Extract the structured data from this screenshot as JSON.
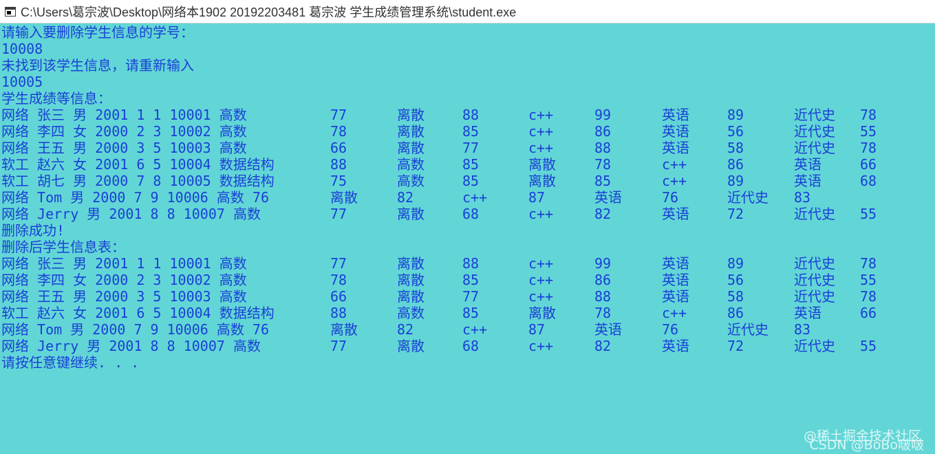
{
  "window": {
    "title": "C:\\Users\\葛宗波\\Desktop\\网络本1902 20192203481 葛宗波 学生成绩管理系统\\student.exe"
  },
  "console": {
    "prompt_delete": "请输入要删除学生信息的学号：",
    "input_first": "10008",
    "not_found": "未找到该学生信息，请重新输入",
    "input_second": "10005",
    "header_info": "学生成绩等信息：",
    "rows_before": [
      [
        "网络 张三 男 2001 1 1 10001 高数",
        "77",
        "离散",
        "88",
        "c++",
        "99",
        "英语",
        "89",
        "近代史",
        "78"
      ],
      [
        "网络 李四 女 2000 2 3 10002 高数",
        "78",
        "离散",
        "85",
        "c++",
        "86",
        "英语",
        "56",
        "近代史",
        "55"
      ],
      [
        "网络 王五 男 2000 3 5 10003 高数",
        "66",
        "离散",
        "77",
        "c++",
        "88",
        "英语",
        "58",
        "近代史",
        "78"
      ],
      [
        "软工 赵六 女 2001 6 5 10004 数据结构",
        "88",
        "高数",
        "85",
        "离散",
        "78",
        "c++",
        "86",
        "英语",
        "66"
      ],
      [
        "软工 胡七 男 2000 7 8 10005 数据结构",
        "75",
        "高数",
        "85",
        "离散",
        "85",
        "c++",
        "89",
        "英语",
        "68"
      ],
      [
        "网络 Tom 男 2000 7 9 10006 高数 76",
        "离散",
        "82",
        "c++",
        "87",
        "英语",
        "76",
        "近代史",
        "83",
        ""
      ],
      [
        "网络 Jerry 男 2001 8 8 10007 高数",
        "77",
        "离散",
        "68",
        "c++",
        "82",
        "英语",
        "72",
        "近代史",
        "55"
      ]
    ],
    "delete_success": "删除成功!",
    "header_after": "删除后学生信息表：",
    "rows_after": [
      [
        "网络 张三 男 2001 1 1 10001 高数",
        "77",
        "离散",
        "88",
        "c++",
        "99",
        "英语",
        "89",
        "近代史",
        "78"
      ],
      [
        "网络 李四 女 2000 2 3 10002 高数",
        "78",
        "离散",
        "85",
        "c++",
        "86",
        "英语",
        "56",
        "近代史",
        "55"
      ],
      [
        "网络 王五 男 2000 3 5 10003 高数",
        "66",
        "离散",
        "77",
        "c++",
        "88",
        "英语",
        "58",
        "近代史",
        "78"
      ],
      [
        "软工 赵六 女 2001 6 5 10004 数据结构",
        "88",
        "高数",
        "85",
        "离散",
        "78",
        "c++",
        "86",
        "英语",
        "66"
      ],
      [
        "网络 Tom 男 2000 7 9 10006 高数 76",
        "离散",
        "82",
        "c++",
        "87",
        "英语",
        "76",
        "近代史",
        "83",
        ""
      ],
      [
        "网络 Jerry 男 2001 8 8 10007 高数",
        "77",
        "离散",
        "68",
        "c++",
        "82",
        "英语",
        "72",
        "近代史",
        "55"
      ]
    ],
    "press_any_key": "请按任意键继续. . ."
  },
  "watermark": {
    "line1": "@稀土掘金技术社区",
    "line2": "CSDN @BoBo啵啵"
  },
  "colors": {
    "console_bg": "#62d6d6",
    "console_text": "#1a3fd6",
    "titlebar_bg": "#ffffff"
  }
}
